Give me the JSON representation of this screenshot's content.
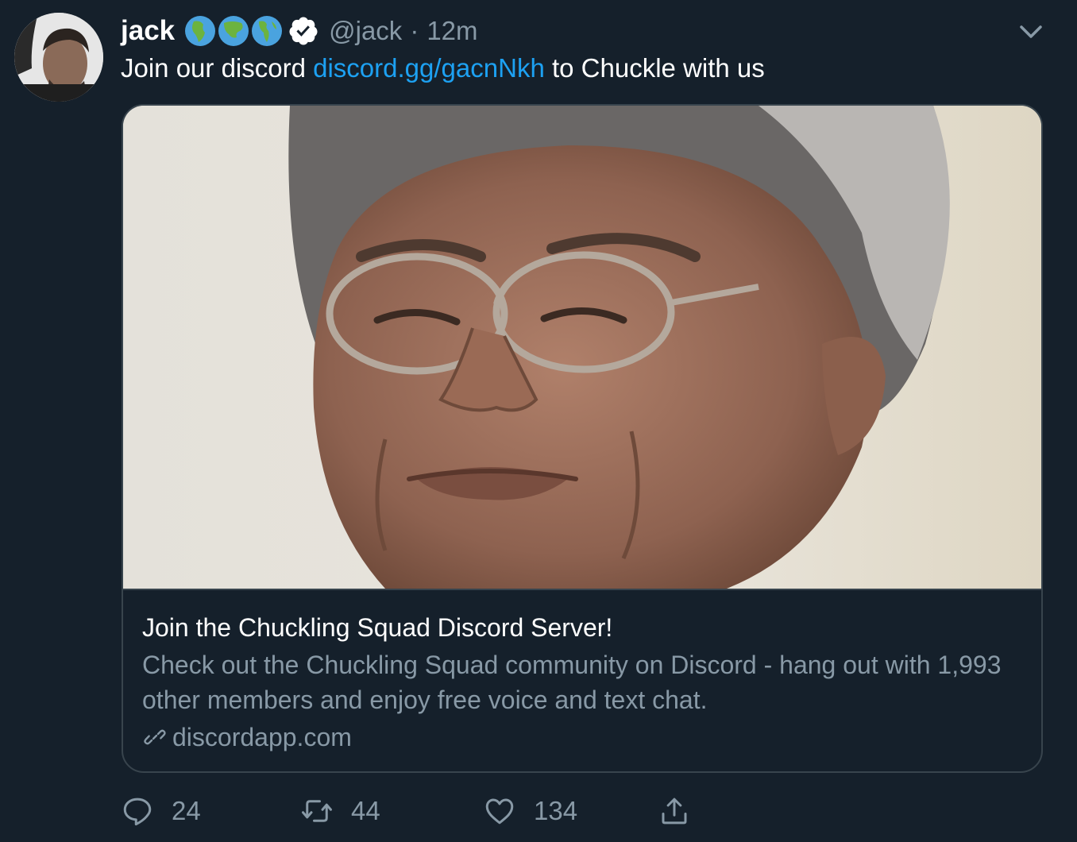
{
  "tweet": {
    "author_name": "jack",
    "handle": "@jack",
    "separator": "·",
    "time": "12m",
    "text_before": "Join our discord ",
    "link": "discord.gg/gacnNkh",
    "text_after": " to Chuckle with us",
    "badges": [
      "globe-africa-icon",
      "globe-asia-icon",
      "globe-americas-icon",
      "verified-badge-icon"
    ]
  },
  "card": {
    "title": "Join the Chuckling Squad Discord Server!",
    "description": "Check out the Chuckling Squad community on Discord - hang out with 1,993 other members and enjoy free voice and text chat.",
    "domain": "discordapp.com"
  },
  "actions": {
    "replies": "24",
    "retweets": "44",
    "likes": "134"
  },
  "colors": {
    "background": "#15202b",
    "link": "#1da1f2",
    "secondary_text": "#8899a6",
    "border": "#38444d"
  }
}
